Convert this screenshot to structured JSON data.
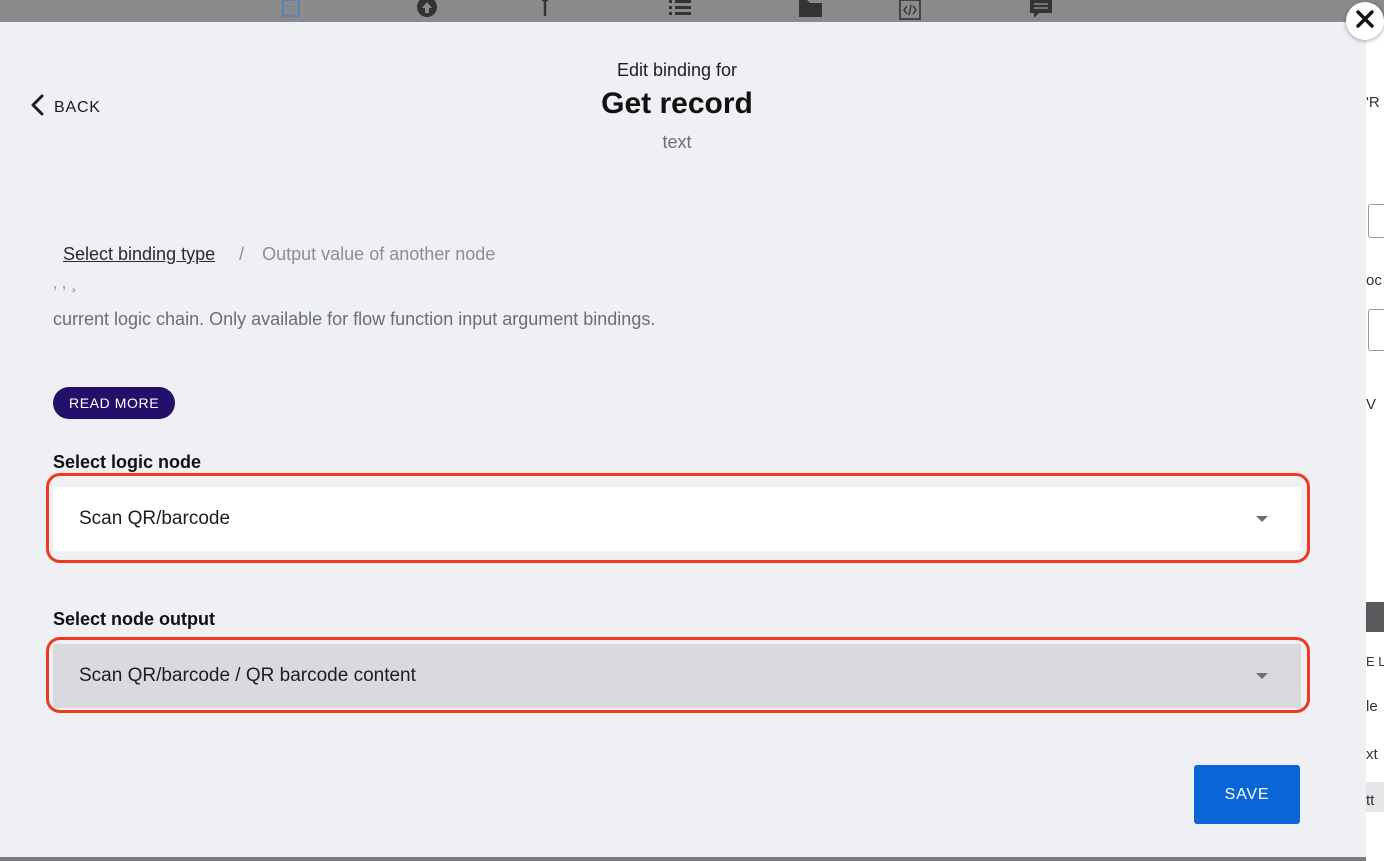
{
  "header": {
    "subtitle": "Edit binding for",
    "title": "Get record",
    "type": "text"
  },
  "nav": {
    "back_label": "BACK"
  },
  "breadcrumb": {
    "link": "Select binding type",
    "separator": "/",
    "current": "Output value of another node"
  },
  "description": {
    "text": "current logic chain. Only available for flow function input argument bindings.",
    "read_more": "READ MORE"
  },
  "logic_node": {
    "label": "Select logic node",
    "value": "Scan QR/barcode"
  },
  "node_output": {
    "label": "Select node output",
    "value": "Scan QR/barcode / QR barcode content"
  },
  "actions": {
    "save_label": "SAVE"
  },
  "background_fragments": [
    "'R",
    "oc",
    "V",
    "E L",
    "le",
    "xt",
    "tt"
  ],
  "colors": {
    "modal_bg": "#eff0f4",
    "save_button": "#0a66d6",
    "read_more_button": "#22106a",
    "highlight_border": "#ee3a22",
    "toolbar_icon_active": "#3a6fb5"
  }
}
